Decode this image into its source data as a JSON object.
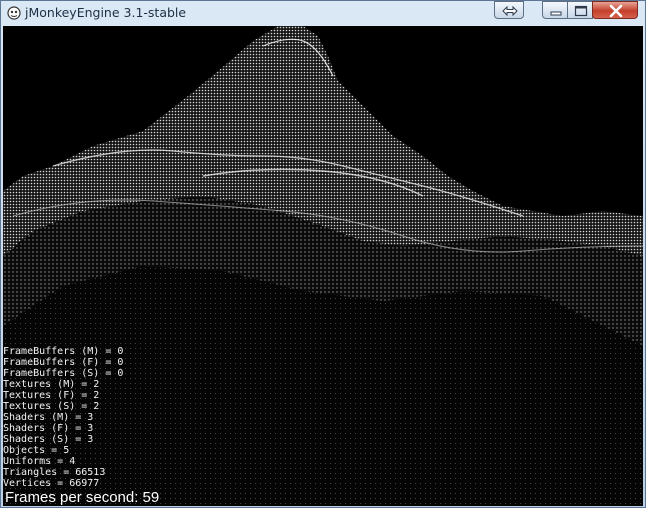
{
  "window": {
    "title": "jMonkeyEngine 3.1-stable",
    "icons": {
      "app": "jmonkey-app-icon",
      "fullscreen": "swap-arrows-icon",
      "minimize": "minimize-icon",
      "maximize": "maximize-icon",
      "close": "close-icon"
    },
    "colors": {
      "close": "#c4402c",
      "frame": "#c9d9ea",
      "viewport": "#000000"
    }
  },
  "viewport": {
    "scene": "wireframe-terrain-mountain",
    "stats": [
      "FrameBuffers (M) = 0",
      "FrameBuffers (F) = 0",
      "FrameBuffers (S) = 0",
      "Textures (M) = 2",
      "Textures (F) = 2",
      "Textures (S) = 2",
      "Shaders (M) = 3",
      "Shaders (F) = 3",
      "Shaders (S) = 3",
      "Objects = 5",
      "Uniforms = 4",
      "Triangles = 66513",
      "Vertices = 66977"
    ],
    "fps_text": "Frames per second: 59"
  }
}
